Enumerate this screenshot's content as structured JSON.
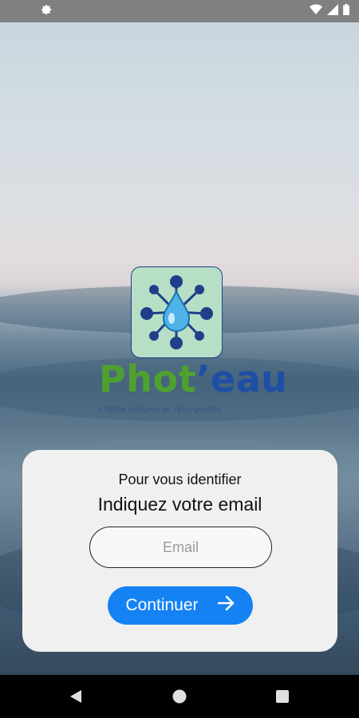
{
  "status_bar": {
    "left_icons": [
      "settings-gear-icon"
    ],
    "right_icons": [
      "wifi-icon",
      "cellular-signal-icon",
      "battery-icon"
    ]
  },
  "brand": {
    "name_part1": "Phot",
    "name_part2": "’eau",
    "tagline": "L'Alliée intégrée de l'éco-gestion",
    "logo_icon": "water-drop-network-icon"
  },
  "card": {
    "subtitle": "Pour vous identifier",
    "title": "Indiquez votre email",
    "email": {
      "value": "",
      "placeholder": "Email"
    },
    "continue_label": "Continuer",
    "continue_icon": "arrow-right-icon"
  },
  "nav_bar": {
    "icons": [
      "back-icon",
      "home-icon",
      "recents-icon"
    ]
  },
  "colors": {
    "accent": "#1582f4",
    "brand_green": "#4ea12f",
    "brand_blue": "#1f4ea6",
    "card_bg": "#f0f0f0"
  }
}
